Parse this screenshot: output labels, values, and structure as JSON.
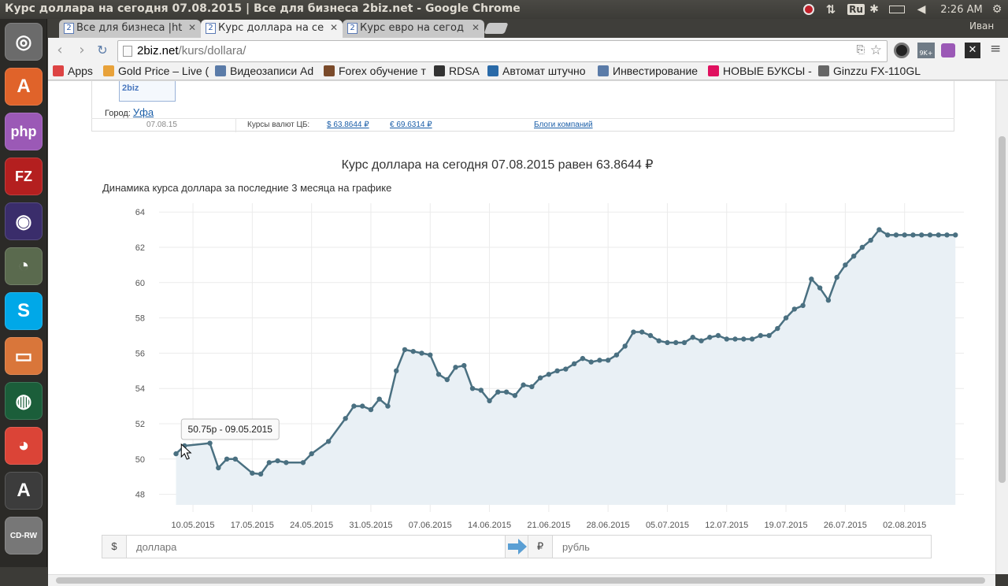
{
  "window": {
    "title": "Курс доллара на сегодня 07.08.2015 | Все для бизнеса 2biz.net - Google Chrome"
  },
  "panel": {
    "lang": "Ru",
    "time": "2:26 AM",
    "user": "Иван"
  },
  "launcher": [
    {
      "name": "ubuntu-dash-icon",
      "glyph": "◎",
      "color": "#6b6b6b"
    },
    {
      "name": "software-center-icon",
      "glyph": "A",
      "color": "#e0632a"
    },
    {
      "name": "phpstorm-icon",
      "glyph": "php",
      "color": "#9b59b6"
    },
    {
      "name": "filezilla-icon",
      "glyph": "FZ",
      "color": "#b41f1f"
    },
    {
      "name": "eclipse-icon",
      "glyph": "◉",
      "color": "#3a2d6b"
    },
    {
      "name": "system-monitor-icon",
      "glyph": "◔",
      "color": "#5a6a4e"
    },
    {
      "name": "skype-icon",
      "glyph": "S",
      "color": "#00a8e8"
    },
    {
      "name": "files-icon",
      "glyph": "▭",
      "color": "#d9763a"
    },
    {
      "name": "camera-icon",
      "glyph": "◍",
      "color": "#1b5e3a"
    },
    {
      "name": "chrome-icon",
      "glyph": "◕",
      "color": "#db4437"
    },
    {
      "name": "updater-icon",
      "glyph": "A",
      "color": "#3c3c3c"
    },
    {
      "name": "cdrw-icon",
      "glyph": "CD-RW",
      "color": "#777777"
    }
  ],
  "tabs": [
    {
      "label": "Все для бизнеса |ht",
      "fav": "2",
      "active": false
    },
    {
      "label": "Курс доллара на се",
      "fav": "2",
      "active": true
    },
    {
      "label": "Курс евро на сегод",
      "fav": "2",
      "active": false
    }
  ],
  "omnibox": {
    "host": "2biz.net",
    "path": "/kurs/dollara/"
  },
  "bookmarks": [
    {
      "label": "Apps",
      "color": "#d44"
    },
    {
      "label": "Gold Price – Live (",
      "color": "#e8a23a"
    },
    {
      "label": "Видеозаписи Ad",
      "color": "#5a7ba8"
    },
    {
      "label": "Forex обучение т",
      "color": "#7a4a2a"
    },
    {
      "label": "RDSA",
      "color": "#333"
    },
    {
      "label": "Автомат штучно",
      "color": "#2a6aa8"
    },
    {
      "label": "Инвестирование",
      "color": "#5a7ba8"
    },
    {
      "label": "НОВЫЕ БУКСЫ -",
      "color": "#e0115f"
    },
    {
      "label": "Ginzzu FX-110GL",
      "color": "#666"
    }
  ],
  "header": {
    "logo_text": "2biz",
    "city_label": "Город:",
    "city": "Уфа",
    "date": "07.08.15",
    "rates_label": "Курсы валют ЦБ:",
    "usd_rate": "$ 63.8644 ₽",
    "eur_rate": "€ 69.6314 ₽",
    "blogs": "Блоги компаний"
  },
  "page": {
    "title": "Курс доллара на сегодня 07.08.2015 равен 63.8644 ₽",
    "subtitle": "Динамика курса доллара за последние 3 месяца на графике"
  },
  "chart_data": {
    "type": "area",
    "ylim": [
      47,
      64.5
    ],
    "yticks": [
      48,
      50,
      52,
      54,
      56,
      58,
      60,
      62,
      64
    ],
    "xticks": [
      "10.05.2015",
      "17.05.2015",
      "24.05.2015",
      "31.05.2015",
      "07.06.2015",
      "14.06.2015",
      "21.06.2015",
      "28.06.2015",
      "05.07.2015",
      "12.07.2015",
      "19.07.2015",
      "26.07.2015",
      "02.08.2015"
    ],
    "grid": true,
    "tooltip": "50.75р - 09.05.2015",
    "line_color": "#4a7081",
    "fill_color": "#e9f0f5",
    "x_days": [
      -2,
      -1,
      2,
      3,
      4,
      5,
      7,
      8,
      9,
      10,
      11,
      13,
      14,
      16,
      18,
      19,
      20,
      21,
      22,
      23,
      24,
      25,
      26,
      27,
      28,
      29,
      30,
      31,
      32,
      33,
      34,
      35,
      36,
      37,
      38,
      39,
      40,
      41,
      42,
      43,
      44,
      45,
      46,
      47,
      48,
      49,
      50,
      51,
      52,
      53,
      54,
      55,
      56,
      57,
      58,
      59,
      60,
      61,
      62,
      63,
      64,
      65,
      66,
      67,
      68,
      69,
      70,
      71,
      72,
      73,
      74,
      75,
      76,
      77,
      78,
      79,
      80,
      81,
      82,
      83,
      84,
      85,
      86,
      87,
      88,
      89,
      90
    ],
    "values": [
      50.3,
      50.75,
      50.9,
      49.5,
      50.0,
      50.0,
      49.2,
      49.15,
      49.8,
      49.9,
      49.8,
      49.8,
      50.3,
      51.0,
      52.3,
      53.0,
      53.0,
      52.8,
      53.4,
      53.0,
      55.0,
      56.2,
      56.1,
      56.0,
      55.9,
      54.8,
      54.5,
      55.2,
      55.3,
      54.0,
      53.9,
      53.3,
      53.8,
      53.8,
      53.6,
      54.2,
      54.1,
      54.6,
      54.8,
      55.0,
      55.1,
      55.4,
      55.7,
      55.5,
      55.6,
      55.6,
      55.9,
      56.4,
      57.2,
      57.2,
      57.0,
      56.7,
      56.6,
      56.6,
      56.6,
      56.9,
      56.7,
      56.9,
      57.0,
      56.8,
      56.8,
      56.8,
      56.8,
      57.0,
      57.0,
      57.4,
      58.0,
      58.5,
      58.7,
      60.2,
      59.7,
      59.0,
      60.3,
      61.0,
      61.5,
      62.0,
      62.4,
      63.0,
      62.7,
      62.7,
      62.7,
      62.7,
      62.7,
      62.7,
      62.7,
      62.7,
      62.7
    ]
  },
  "converter": {
    "from_symbol": "$",
    "from_placeholder": "доллара",
    "to_symbol": "₽",
    "to_placeholder": "рубль"
  }
}
